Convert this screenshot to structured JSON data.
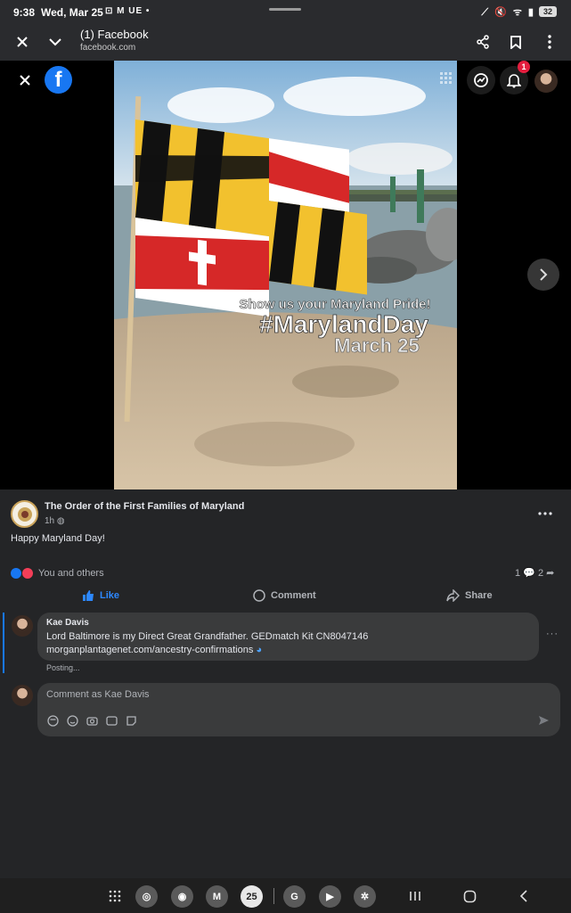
{
  "status_bar": {
    "time": "9:38",
    "date": "Wed, Mar 25",
    "notification_icons": "⊡ M UE •",
    "battery": "32"
  },
  "browser": {
    "title": "(1) Facebook",
    "url": "facebook.com"
  },
  "media": {
    "image_text": {
      "line1": "Show us your Maryland Pride!",
      "line2": "#MarylandDay",
      "line3": "March 25"
    },
    "notification_count": "1"
  },
  "post": {
    "page_name": "The Order of the First Families of Maryland",
    "time": "1h",
    "text": "Happy Maryland Day!",
    "reactions_text": "You and others",
    "comment_count": "1",
    "share_count": "2",
    "actions": {
      "like": "Like",
      "comment": "Comment",
      "share": "Share"
    }
  },
  "comment": {
    "author": "Kae Davis",
    "text_line1": "Lord Baltimore is my Direct Great Grandfather. GEDmatch Kit CN8047146",
    "text_line2": "morganplantagenet.com/ancestry-confirmations",
    "status": "Posting..."
  },
  "composer": {
    "placeholder": "Comment as Kae Davis"
  },
  "navbar": {
    "calendar_day": "25"
  },
  "colors": {
    "accent": "#1877f2",
    "background": "#242527",
    "bubble": "#3a3b3c"
  }
}
